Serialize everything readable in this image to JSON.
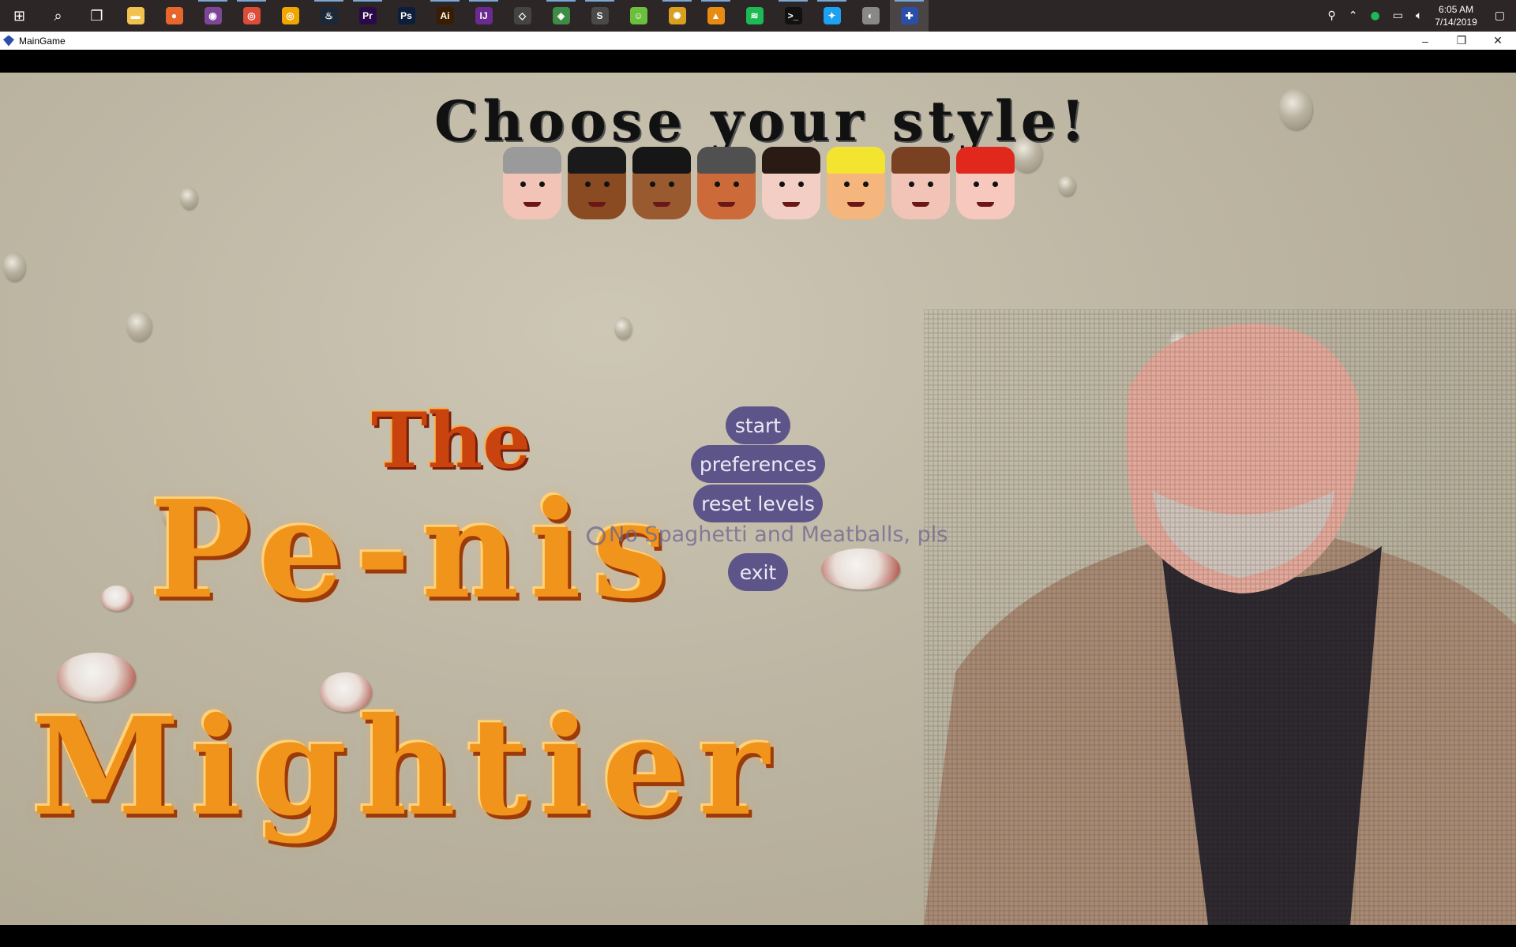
{
  "taskbar": {
    "apps": [
      {
        "name": "start-icon",
        "glyph": "⊞",
        "bg": "transparent"
      },
      {
        "name": "search-icon",
        "glyph": "⌕",
        "bg": "transparent"
      },
      {
        "name": "task-view-icon",
        "glyph": "❐",
        "bg": "transparent"
      },
      {
        "name": "file-explorer-icon",
        "glyph": "▬",
        "bg": "#f2c14e"
      },
      {
        "name": "firefox-icon",
        "glyph": "●",
        "bg": "#e8652c"
      },
      {
        "name": "tor-icon",
        "glyph": "◉",
        "bg": "#7d4698"
      },
      {
        "name": "chrome-icon",
        "glyph": "◎",
        "bg": "#dd4b39"
      },
      {
        "name": "chrome-canary-icon",
        "glyph": "◎",
        "bg": "#f0a500"
      },
      {
        "name": "steam-icon",
        "glyph": "♨",
        "bg": "#1b2838"
      },
      {
        "name": "premiere-icon",
        "glyph": "Pr",
        "bg": "#2a0b48"
      },
      {
        "name": "photoshop-icon",
        "glyph": "Ps",
        "bg": "#0c1e3c"
      },
      {
        "name": "illustrator-icon",
        "glyph": "Ai",
        "bg": "#3a1c00"
      },
      {
        "name": "intellij-icon",
        "glyph": "IJ",
        "bg": "#6b2a8f"
      },
      {
        "name": "unity-icon",
        "glyph": "◇",
        "bg": "#444"
      },
      {
        "name": "android-studio-icon",
        "glyph": "◈",
        "bg": "#3d8b44"
      },
      {
        "name": "sublime-icon",
        "glyph": "S",
        "bg": "#4a4a4a"
      },
      {
        "name": "app-person-icon",
        "glyph": "☺",
        "bg": "#6bbf3c"
      },
      {
        "name": "sun-app-icon",
        "glyph": "✺",
        "bg": "#d9a020"
      },
      {
        "name": "vlc-icon",
        "glyph": "▲",
        "bg": "#e78b12"
      },
      {
        "name": "spotify-icon",
        "glyph": "≋",
        "bg": "#1db954"
      },
      {
        "name": "terminal-icon",
        "glyph": ">_",
        "bg": "#111"
      },
      {
        "name": "twitter-icon",
        "glyph": "✦",
        "bg": "#1da1f2"
      },
      {
        "name": "mouse-app-icon",
        "glyph": "◐",
        "bg": "#888"
      },
      {
        "name": "maingame-icon",
        "glyph": "✚",
        "bg": "#2b4fa8"
      }
    ],
    "clock_time": "6:05 AM",
    "clock_date": "7/14/2019"
  },
  "window": {
    "title": "MainGame",
    "minimize": "–",
    "restore": "❐",
    "close": "✕"
  },
  "game": {
    "headline": "Choose your style!",
    "faces": [
      {
        "name": "face-gray-hair",
        "hair": "#9a9a9a",
        "skin": "#f2c4b8"
      },
      {
        "name": "face-black-beard",
        "hair": "#1a1a1a",
        "skin": "#8a4a22"
      },
      {
        "name": "face-dark-brown",
        "hair": "#161616",
        "skin": "#9a5a30"
      },
      {
        "name": "face-gray-beard",
        "hair": "#505050",
        "skin": "#cc6a3a"
      },
      {
        "name": "face-mustache",
        "hair": "#2a1a14",
        "skin": "#f2cec4"
      },
      {
        "name": "face-blonde",
        "hair": "#f3e430",
        "skin": "#f4b67c"
      },
      {
        "name": "face-brown-hair",
        "hair": "#7a4022",
        "skin": "#f2c4b8"
      },
      {
        "name": "face-red-hair",
        "hair": "#e0281c",
        "skin": "#f6c8be"
      }
    ],
    "menu": {
      "start": "start",
      "preferences": "preferences",
      "reset_levels": "reset levels",
      "exit": "exit",
      "spaghetti_option": "No Spaghetti and Meatballs, pls"
    },
    "logo": {
      "line1": "The",
      "line2": "Pe-nis",
      "line3": "Mightier"
    },
    "colors": {
      "button_bg": "#5d5589",
      "logo_orange": "#f0941b",
      "logo_red": "#c9430f"
    }
  }
}
